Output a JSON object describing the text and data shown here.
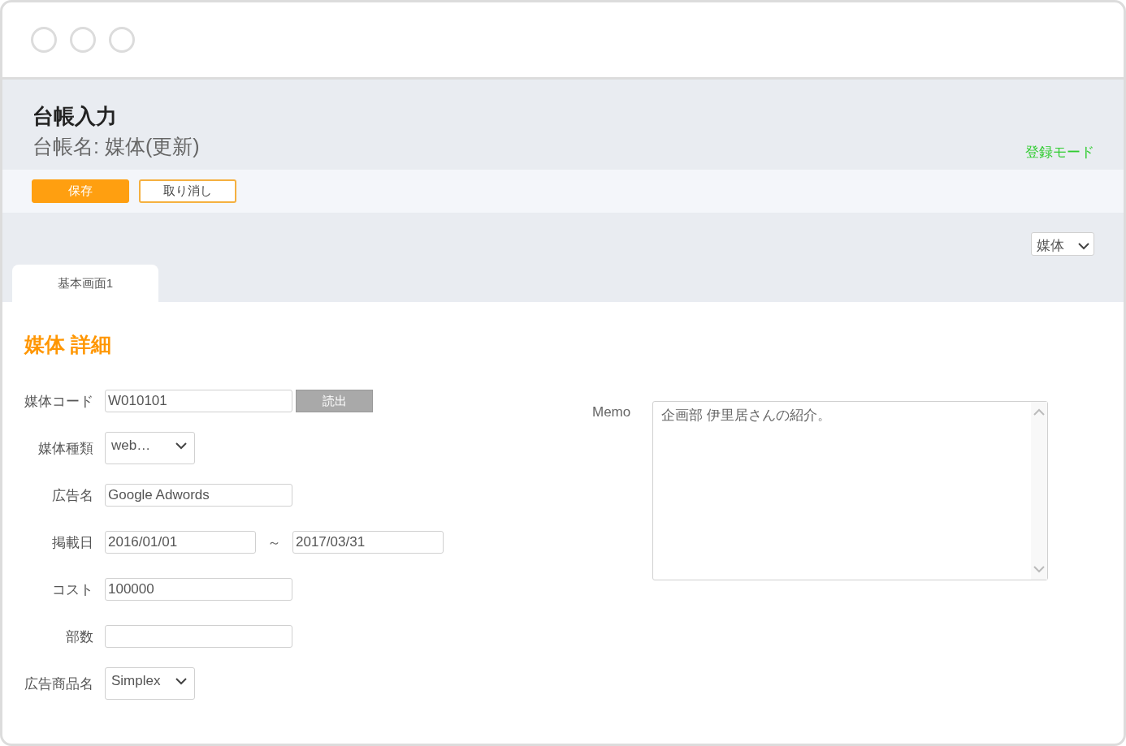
{
  "header": {
    "title": "台帳入力",
    "subtitle": "台帳名: 媒体(更新)",
    "mode": "登録モード"
  },
  "toolbar": {
    "buttons": [
      {
        "label": "保存",
        "kind": "primary"
      },
      {
        "label": "取り消し",
        "kind": "secondary"
      }
    ]
  },
  "view_select": {
    "value": "媒体"
  },
  "tabs": [
    {
      "label": "基本画面1",
      "selected": true
    }
  ],
  "section": {
    "title": "媒体 詳細"
  },
  "fields": [
    {
      "label": "媒体コード",
      "kind": "text",
      "value": "W010101",
      "button": "読出"
    },
    {
      "label": "媒体種類",
      "kind": "select",
      "value": "web…"
    },
    {
      "label": "広告名",
      "kind": "text",
      "value": "Google Adwords"
    },
    {
      "label": "掲載日",
      "kind": "range",
      "from": "2016/01/01",
      "separator": "～",
      "to": "2017/03/31"
    },
    {
      "label": "コスト",
      "kind": "text",
      "value": "100000"
    },
    {
      "label": "部数",
      "kind": "text"
    },
    {
      "label": "広告商品名",
      "kind": "select",
      "value": "Simplex"
    }
  ],
  "memo": {
    "label": "Memo",
    "value": "企画部 伊里居さんの紹介。"
  }
}
